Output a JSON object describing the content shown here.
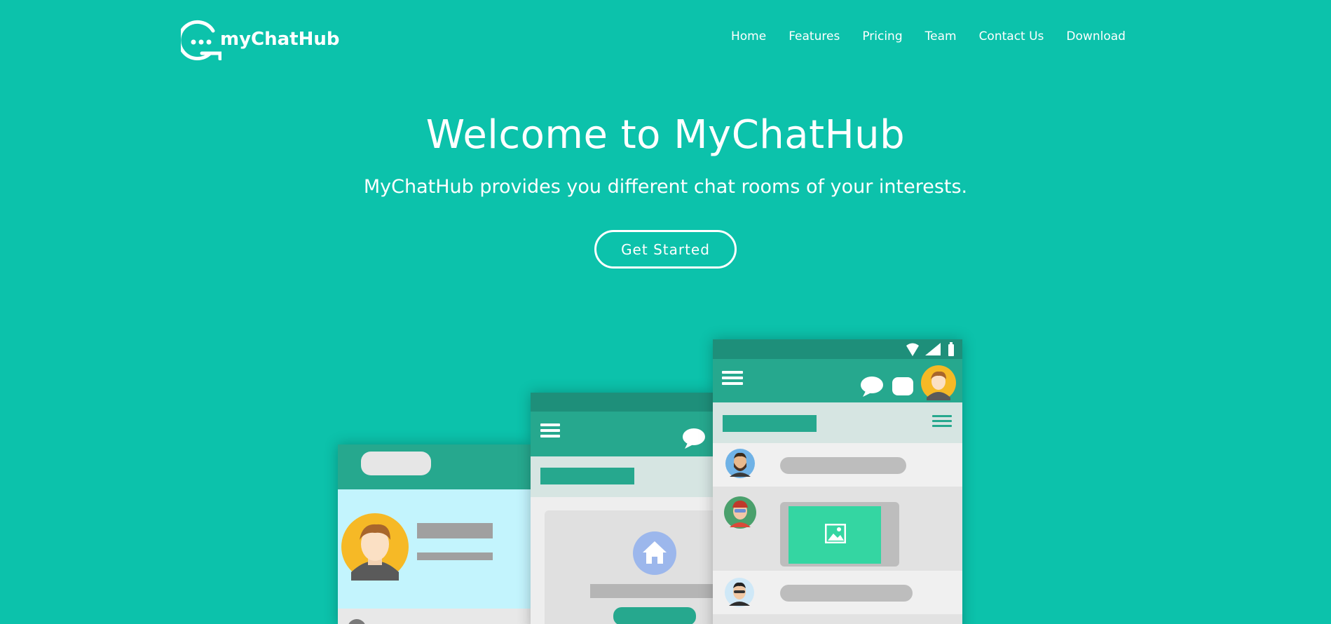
{
  "brand": {
    "name": "myChatHub",
    "bg_color": "#0cc2ab",
    "accent": "#26a88e"
  },
  "nav": {
    "items": [
      {
        "label": "Home"
      },
      {
        "label": "Features"
      },
      {
        "label": "Pricing"
      },
      {
        "label": "Team"
      },
      {
        "label": "Contact Us"
      },
      {
        "label": "Download"
      }
    ]
  },
  "hero": {
    "title": "Welcome to MyChatHub",
    "subtitle": "MyChatHub provides you different chat rooms of your interests.",
    "cta_label": "Get Started"
  },
  "illustration": {
    "icons": [
      "menu-icon",
      "chat-bubble-icon",
      "wifi-icon",
      "signal-icon",
      "battery-icon",
      "home-icon",
      "image-icon",
      "avatar-icon"
    ]
  }
}
